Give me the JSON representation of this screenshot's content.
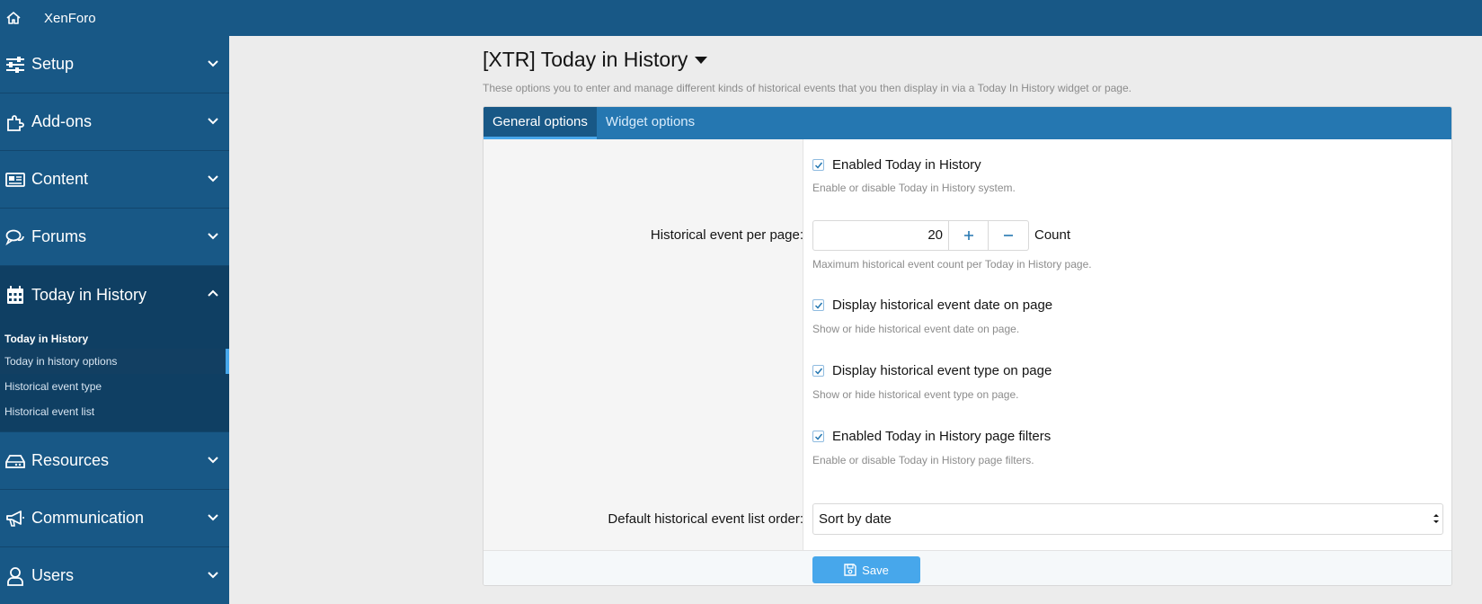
{
  "topbar": {
    "brand": "XenForo",
    "home_icon": "home-icon"
  },
  "sidebar": {
    "sections": [
      {
        "label": "Setup",
        "icon": "sliders-icon"
      },
      {
        "label": "Add-ons",
        "icon": "puzzle-icon"
      },
      {
        "label": "Content",
        "icon": "newspaper-icon"
      },
      {
        "label": "Forums",
        "icon": "comments-icon"
      },
      {
        "label": "Today in History",
        "icon": "calendar-icon"
      },
      {
        "label": "Resources",
        "icon": "hdd-icon"
      },
      {
        "label": "Communication",
        "icon": "megaphone-icon"
      },
      {
        "label": "Users",
        "icon": "user-icon"
      }
    ],
    "subnav": {
      "heading": "Today in History",
      "items": [
        "Today in history options",
        "Historical event type",
        "Historical event list"
      ]
    }
  },
  "page": {
    "title": "[XTR] Today in History",
    "description": "These options you to enter and manage different kinds of historical events that you then display in via a Today In History widget or page."
  },
  "tabs": [
    "General options",
    "Widget options"
  ],
  "options": {
    "enabled": {
      "label": "Enabled Today in History",
      "explain": "Enable or disable Today in History system.",
      "checked": true
    },
    "per_page": {
      "label": "Historical event per page:",
      "value": "20",
      "unit": "Count",
      "explain": "Maximum historical event count per Today in History page."
    },
    "show_date": {
      "label": "Display historical event date on page",
      "explain": "Show or hide historical event date on page.",
      "checked": true
    },
    "show_type": {
      "label": "Display historical event type on page",
      "explain": "Show or hide historical event type on page.",
      "checked": true
    },
    "filters": {
      "label": "Enabled Today in History page filters",
      "explain": "Enable or disable Today in History page filters.",
      "checked": true
    },
    "order": {
      "label": "Default historical event list order:",
      "value": "Sort by date"
    }
  },
  "save_label": "Save",
  "colors": {
    "nav": "#185886",
    "accent": "#47a7eb",
    "tabbar": "#2577b1"
  }
}
